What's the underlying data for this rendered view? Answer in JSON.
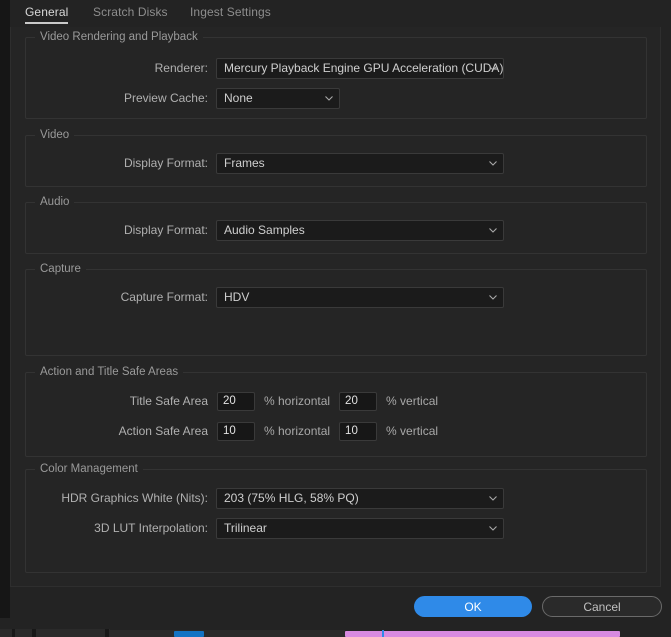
{
  "dialog": {
    "tabs": [
      {
        "id": "general",
        "label": "General",
        "active": true
      },
      {
        "id": "scratch",
        "label": "Scratch Disks",
        "active": false
      },
      {
        "id": "ingest",
        "label": "Ingest Settings",
        "active": false
      }
    ],
    "groups": {
      "video_rendering": {
        "title": "Video Rendering and Playback",
        "renderer_label": "Renderer:",
        "renderer_value": "Mercury Playback Engine GPU Acceleration (CUDA)",
        "preview_cache_label": "Preview Cache:",
        "preview_cache_value": "None"
      },
      "video": {
        "title": "Video",
        "display_format_label": "Display Format:",
        "display_format_value": "Frames"
      },
      "audio": {
        "title": "Audio",
        "display_format_label": "Display Format:",
        "display_format_value": "Audio Samples"
      },
      "capture": {
        "title": "Capture",
        "capture_format_label": "Capture Format:",
        "capture_format_value": "HDV"
      },
      "safe_areas": {
        "title": "Action and Title Safe Areas",
        "title_safe_label": "Title Safe Area",
        "title_safe_h_value": "20",
        "title_safe_h_unit": "% horizontal",
        "title_safe_v_value": "20",
        "title_safe_v_unit": "% vertical",
        "action_safe_label": "Action Safe Area",
        "action_safe_h_value": "10",
        "action_safe_h_unit": "% horizontal",
        "action_safe_v_value": "10",
        "action_safe_v_unit": "% vertical"
      },
      "color_management": {
        "title": "Color Management",
        "hdr_white_label": "HDR Graphics White (Nits):",
        "hdr_white_value": "203 (75% HLG, 58% PQ)",
        "lut_label": "3D LUT Interpolation:",
        "lut_value": "Trilinear"
      }
    },
    "footer": {
      "ok_label": "OK",
      "cancel_label": "Cancel"
    }
  },
  "colors": {
    "accent_blue": "#2f8ae8",
    "panel_bg": "#252525",
    "window_bg": "#232323",
    "field_bg": "#1b1b1b",
    "group_border": "#333333",
    "text_primary": "#cfcfcf",
    "text_label": "#b0b0b0",
    "clip_magenta": "#d88ae0"
  },
  "icons": {
    "chevron_down": "chevron-down-icon"
  }
}
